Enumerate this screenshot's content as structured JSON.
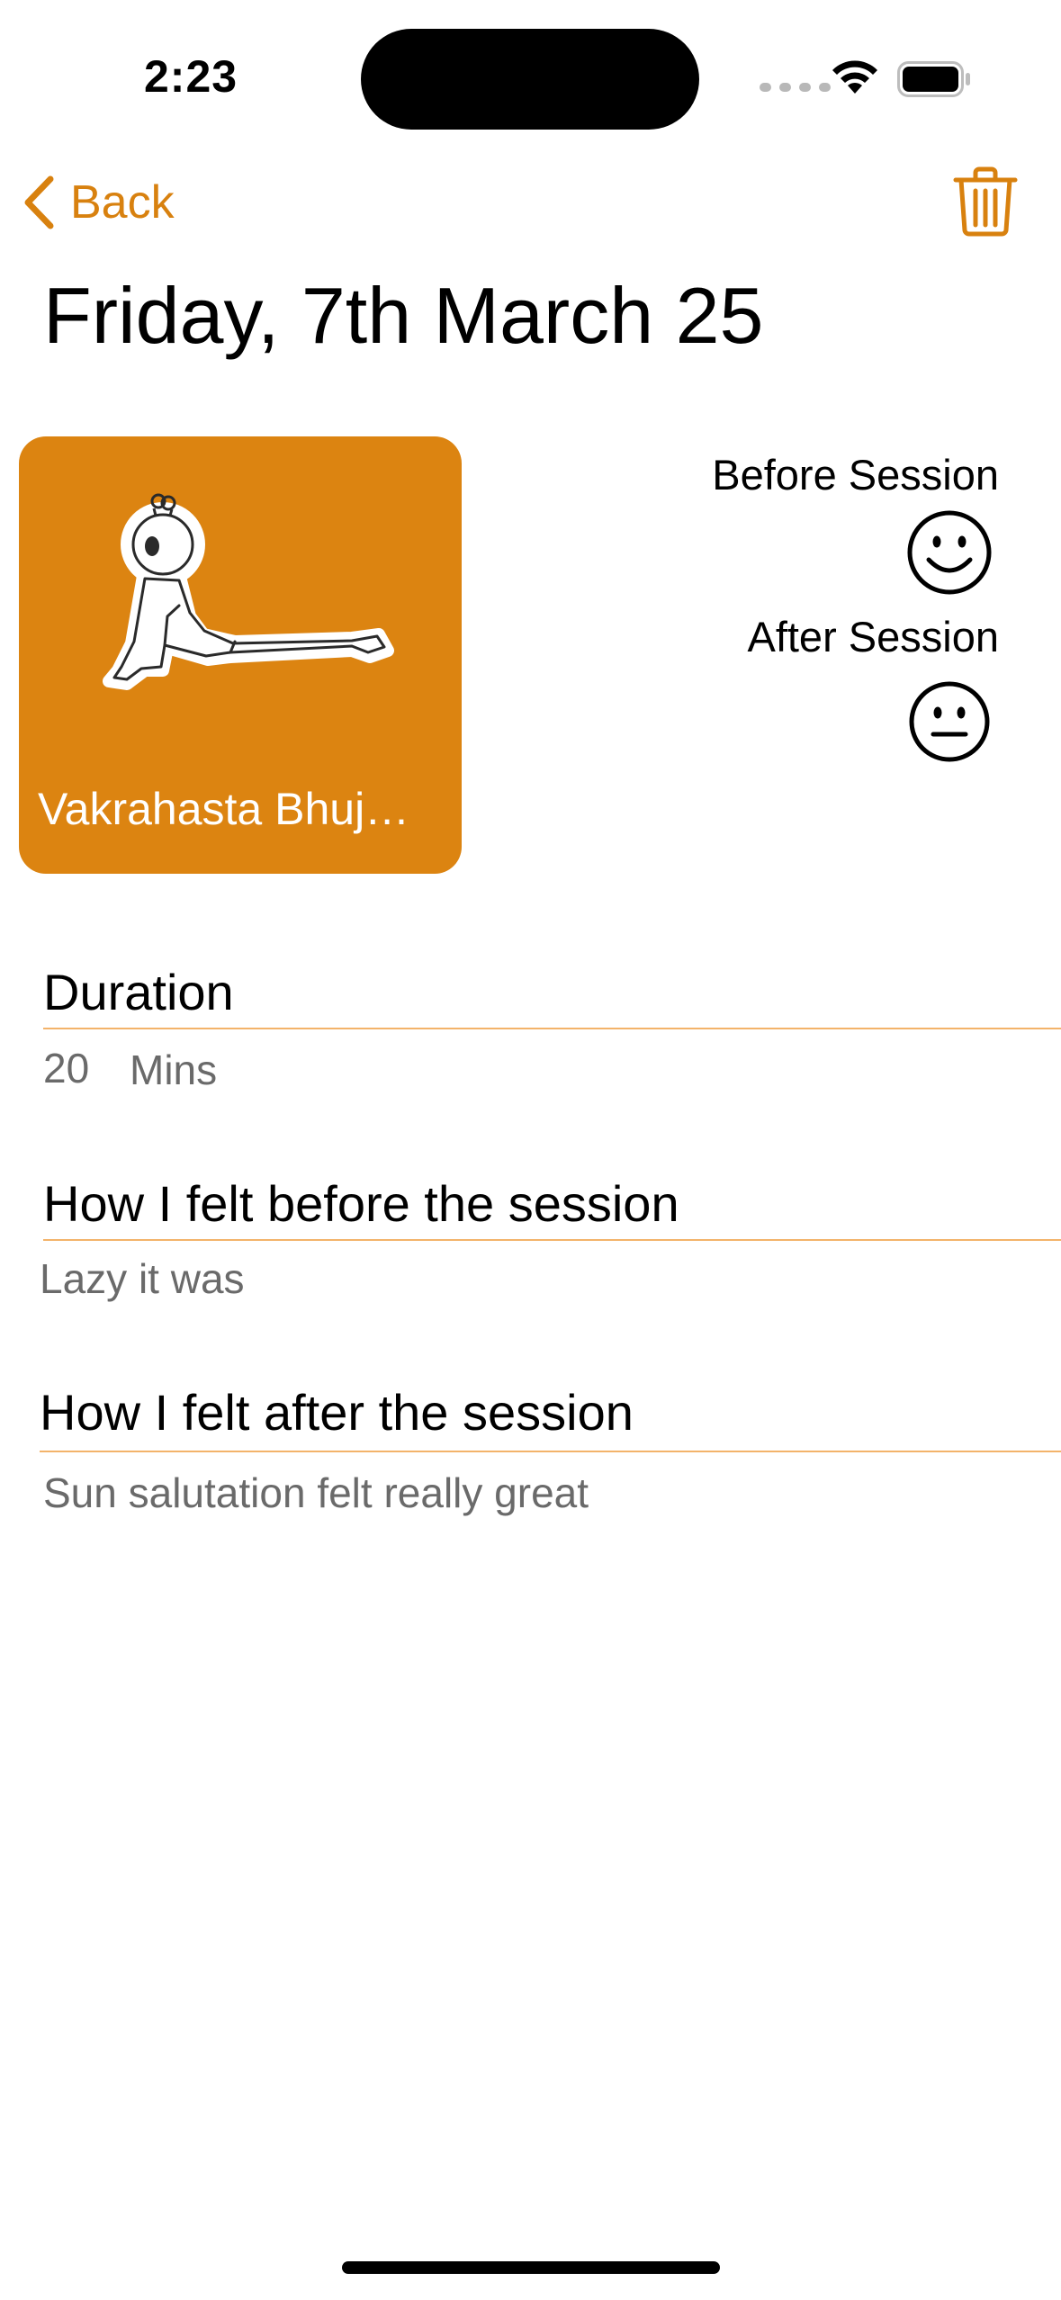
{
  "status_bar": {
    "time": "2:23",
    "icons": [
      "cellular-signal-icon",
      "wifi-icon",
      "battery-icon"
    ]
  },
  "nav": {
    "back_label": "Back",
    "back_icon": "chevron-left-icon",
    "delete_icon": "trash-icon",
    "accent_color": "#d8810f"
  },
  "title": "Friday, 7th March 25",
  "pose_card": {
    "label": "Vakrahasta Bhuj…",
    "image": "yoga-pose-figure",
    "background_color": "#dc8411"
  },
  "mood": {
    "before_label": "Before Session",
    "before_icon": "smiling-face-icon",
    "after_label": "After Session",
    "after_icon": "neutral-face-icon"
  },
  "duration": {
    "heading": "Duration",
    "value": "20",
    "unit": "Mins"
  },
  "felt_before": {
    "heading": "How I felt before the session",
    "text": "Lazy it was"
  },
  "felt_after": {
    "heading": "How I felt after the session",
    "text": "Sun salutation felt really great"
  }
}
